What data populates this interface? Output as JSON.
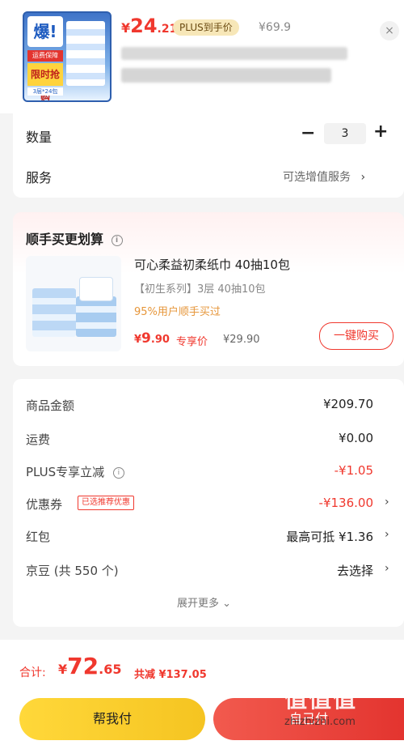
{
  "header": {
    "thumb": {
      "burst": "爆!",
      "tag1": "运费保障",
      "tag2": "限时抢购",
      "tag3": "3层*24包"
    },
    "price": {
      "yen": "¥",
      "int": "24",
      "dec": ".21"
    },
    "plus_badge": "PLUS到手价",
    "orig_price": "¥69.9",
    "close_icon": "×"
  },
  "qty": {
    "label": "数量",
    "value": "3",
    "minus": "−",
    "plus": "+",
    "service_label": "服务",
    "service_value": "可选增值服务",
    "chevron": "›"
  },
  "addon": {
    "title": "顺手买更划算",
    "info": "i",
    "name": "可心柔益初柔纸巾 40抽10包",
    "spec": "【初生系列】3层 40抽10包",
    "rate": "95%用户顺手买过",
    "price": {
      "yen": "¥",
      "int": "9",
      "dec": ".90"
    },
    "exclusive": "专享价",
    "orig_price": "¥29.90",
    "buy_label": "一键购买"
  },
  "summary": {
    "rows": [
      {
        "label": "商品金额",
        "value": "¥209.70"
      },
      {
        "label": "运费",
        "value": "¥0.00"
      },
      {
        "label": "PLUS专享立减",
        "value": "-¥1.05"
      },
      {
        "label": "优惠券",
        "value": "-¥136.00",
        "tag": "已选推荐优惠"
      },
      {
        "label": "红包",
        "value": "最高可抵 ¥1.36"
      },
      {
        "label": "京豆 (共 550 个)",
        "value": "去选择"
      }
    ],
    "more": "展开更多 ⌄"
  },
  "footer": {
    "total_label": "合计:",
    "total": {
      "yen": "¥",
      "int": "72",
      "dec": ".65"
    },
    "total_save": "共减 ¥137.05",
    "help_label": "帮我付",
    "pay_label": "自己付",
    "watermark_logo": "值值值",
    "watermark_url": "zhizhizhi.com"
  },
  "colors": {
    "accent": "#f0382e",
    "help_button": "#ffd83a",
    "plus_badge": "#f7e7b8"
  }
}
